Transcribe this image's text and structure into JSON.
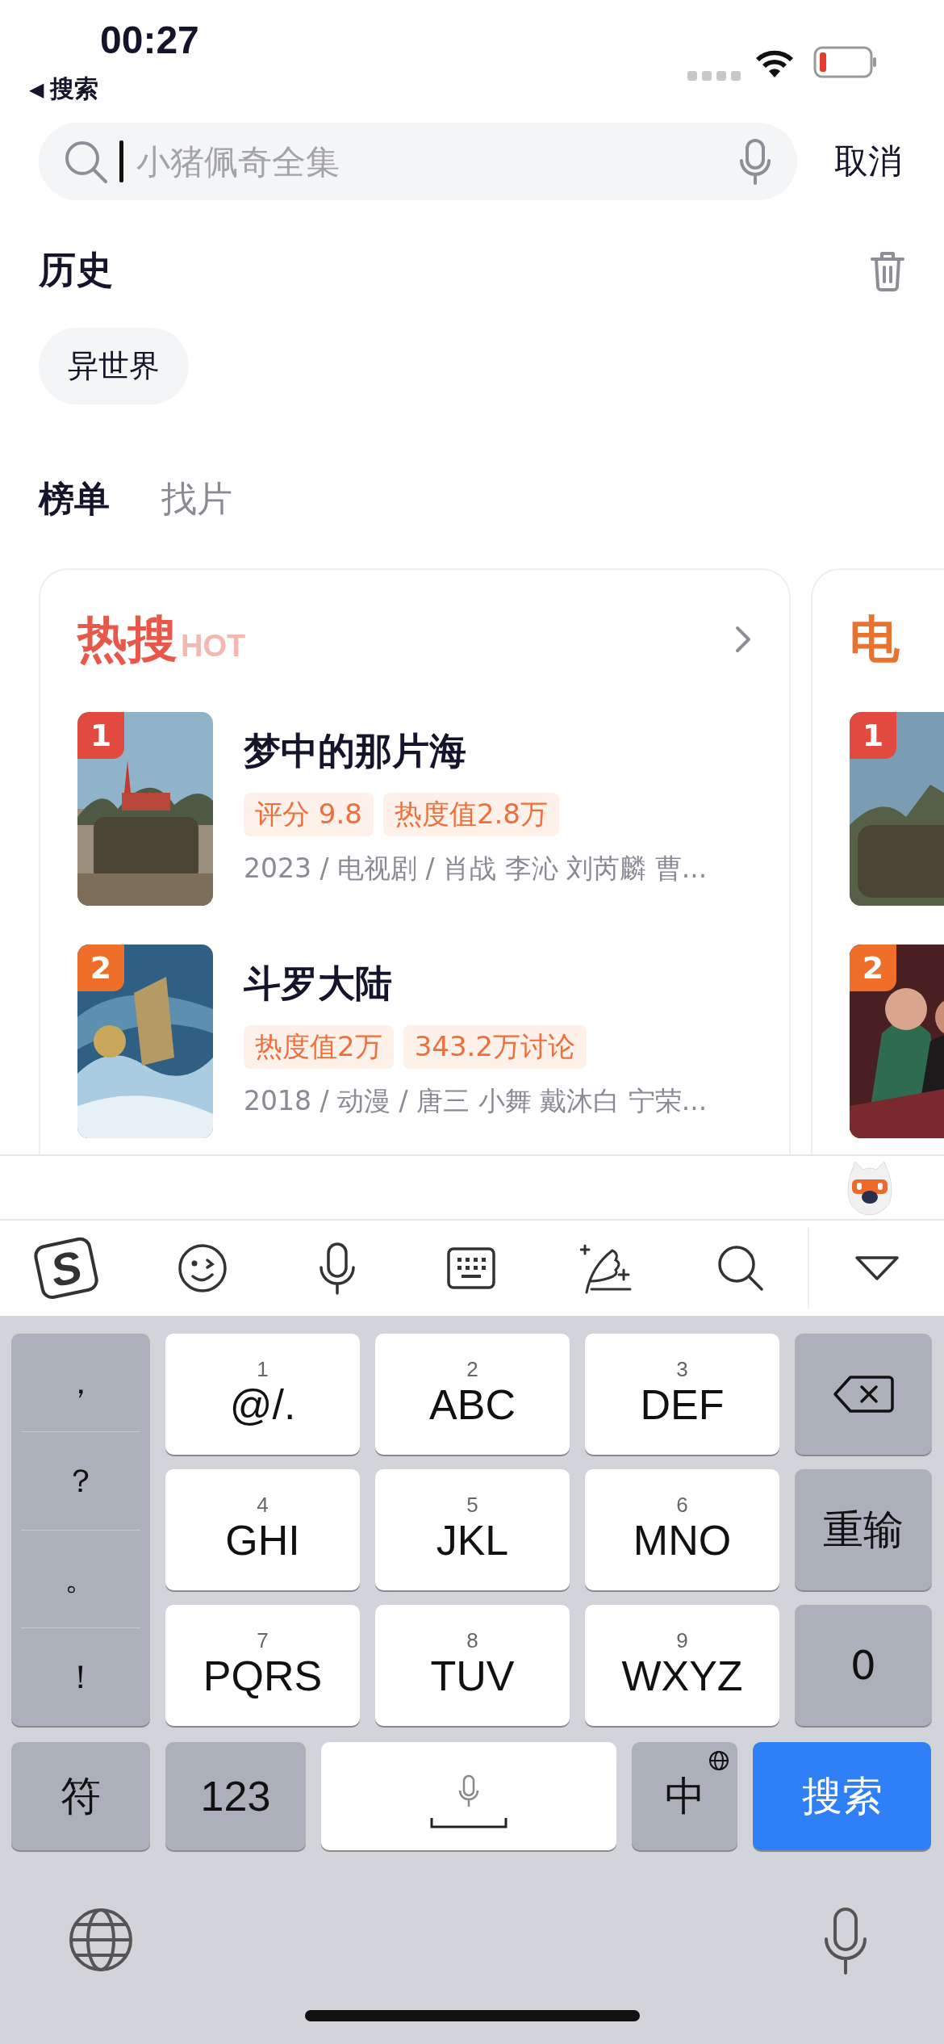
{
  "status_bar": {
    "time": "00:27",
    "back_arrow": "◀",
    "back_label": "搜索"
  },
  "search": {
    "placeholder": "小猪佩奇全集",
    "cancel": "取消"
  },
  "history": {
    "title": "历史",
    "items": [
      "异世界"
    ]
  },
  "tabs": [
    {
      "label": "榜单",
      "selected": true
    },
    {
      "label": "找片",
      "selected": false
    }
  ],
  "boards": [
    {
      "title": "热搜",
      "badge": "HOT",
      "color": "#e8584a",
      "items": [
        {
          "rank": "1",
          "color": "#e2493f",
          "title": "梦中的那片海",
          "tags": [
            "评分 9.8",
            "热度值2.8万"
          ],
          "meta": "2023 / 电视剧 / 肖战 李沁 刘芮麟 曹..."
        },
        {
          "rank": "2",
          "color": "#ef6f2a",
          "title": "斗罗大陆",
          "tags": [
            "热度值2万",
            "343.2万讨论"
          ],
          "meta": "2018 / 动漫 / 唐三 小舞 戴沐白 宁荣..."
        }
      ]
    },
    {
      "title": "电",
      "color": "#e8732f",
      "items": [
        {
          "rank": "1",
          "color": "#e2493f"
        },
        {
          "rank": "2",
          "color": "#ef6f2a"
        }
      ]
    }
  ],
  "keyboard": {
    "logo": "S",
    "left_keys": [
      "，",
      "？",
      "。",
      "！"
    ],
    "keys": [
      {
        "digit": "1",
        "label": "@/."
      },
      {
        "digit": "2",
        "label": "ABC"
      },
      {
        "digit": "3",
        "label": "DEF"
      },
      {
        "digit": "4",
        "label": "GHI"
      },
      {
        "digit": "5",
        "label": "JKL"
      },
      {
        "digit": "6",
        "label": "MNO"
      },
      {
        "digit": "7",
        "label": "PQRS"
      },
      {
        "digit": "8",
        "label": "TUV"
      },
      {
        "digit": "9",
        "label": "WXYZ"
      }
    ],
    "right_keys": [
      {
        "kind": "backspace"
      },
      {
        "kind": "text",
        "label": "重输"
      },
      {
        "kind": "text",
        "label": "0"
      }
    ],
    "symbols": "符",
    "numbers": "123",
    "language": "中",
    "search": "搜索"
  }
}
